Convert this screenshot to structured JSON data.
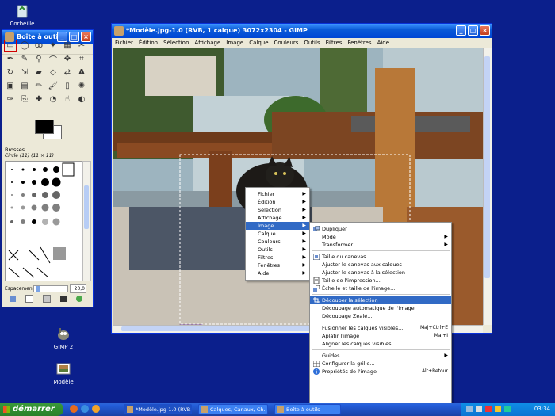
{
  "desktop": {
    "icons": [
      {
        "label": "Corbeille"
      },
      {
        "label": "GIMP 2"
      },
      {
        "label": "Modèle"
      }
    ]
  },
  "toolbox": {
    "title": "Boîte à outils",
    "brushes_title": "Brosses",
    "brush_name": "Circle (11) (11 × 11)",
    "spacing_label": "Espacement :",
    "spacing_value": "20,0"
  },
  "gimp_window": {
    "title": "*Modèle.jpg-1.0 (RVB, 1 calque) 3072x2304 - GIMP",
    "menu": [
      "Fichier",
      "Édition",
      "Sélection",
      "Affichage",
      "Image",
      "Calque",
      "Couleurs",
      "Outils",
      "Filtres",
      "Fenêtres",
      "Aide"
    ]
  },
  "context_menu": {
    "items": [
      {
        "label": "Fichier",
        "submenu": true
      },
      {
        "label": "Édition",
        "submenu": true
      },
      {
        "label": "Sélection",
        "submenu": true
      },
      {
        "label": "Affichage",
        "submenu": true
      },
      {
        "label": "Image",
        "submenu": true,
        "highlighted": true
      },
      {
        "label": "Calque",
        "submenu": true
      },
      {
        "label": "Couleurs",
        "submenu": true
      },
      {
        "label": "Outils",
        "submenu": true
      },
      {
        "label": "Filtres",
        "submenu": true
      },
      {
        "label": "Fenêtres",
        "submenu": true
      },
      {
        "label": "Aide",
        "submenu": true
      }
    ]
  },
  "image_submenu": {
    "items": [
      {
        "label": "Dupliquer",
        "accel": "",
        "icon": "duplicate-icon"
      },
      {
        "label": "Mode",
        "submenu": true
      },
      {
        "label": "Transformer",
        "submenu": true
      },
      {
        "sep": true
      },
      {
        "label": "Taille du canevas...",
        "icon": "canvas-size-icon"
      },
      {
        "label": "Ajuster le canevas aux calques"
      },
      {
        "label": "Ajuster le canevas à la sélection"
      },
      {
        "label": "Taille de l'impression...",
        "icon": "print-size-icon"
      },
      {
        "label": "Échelle et taille de l'image...",
        "icon": "scale-icon"
      },
      {
        "sep": true
      },
      {
        "label": "Découper la sélection",
        "highlighted": true,
        "icon": "crop-icon"
      },
      {
        "label": "Découpage automatique de l'image"
      },
      {
        "label": "Découpage Zealé..."
      },
      {
        "sep": true
      },
      {
        "label": "Fusionner les calques visibles...",
        "accel": "Maj+Ctrl+E"
      },
      {
        "label": "Aplatir l'image",
        "accel": "Maj+I"
      },
      {
        "label": "Aligner les calques visibles..."
      },
      {
        "sep": true
      },
      {
        "label": "Guides",
        "submenu": true
      },
      {
        "label": "Configurer la grille...",
        "icon": "grid-icon"
      },
      {
        "label": "Propriétés de l'image",
        "accel": "Alt+Retour",
        "icon": "info-icon"
      }
    ]
  },
  "taskbar": {
    "start_label": "démarrer",
    "items": [
      {
        "label": "*Modèle.jpg-1.0 (RVB..."
      },
      {
        "label": "Calques, Canaux, Ch..."
      },
      {
        "label": "Boîte à outils"
      }
    ],
    "clock": "03:34"
  },
  "colors": {
    "desktop": "#0b1f8c",
    "xp_title": "#0a5bd8",
    "menu_highlight": "#316ac5",
    "selection_tool_outline": "#d00000"
  }
}
